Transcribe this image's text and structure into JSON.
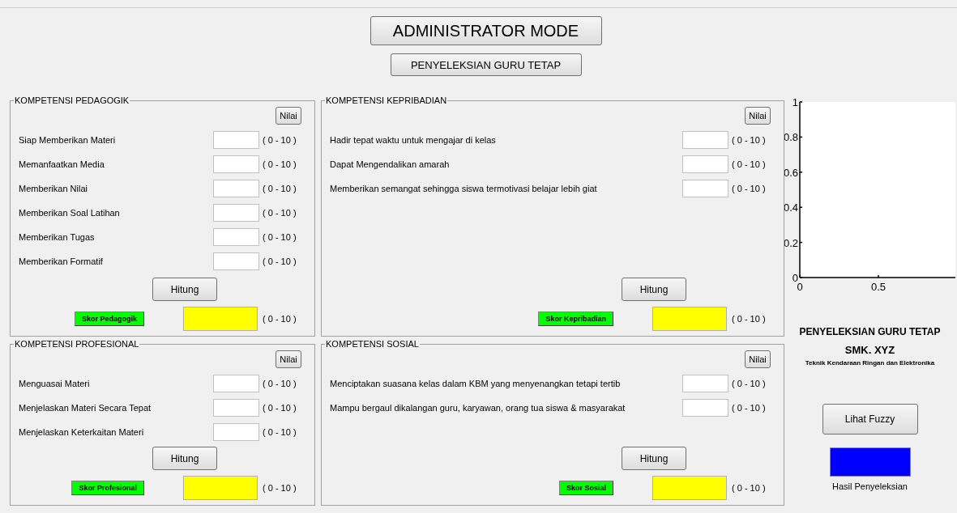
{
  "header": {
    "title": "ADMINISTRATOR MODE",
    "subtitle": "PENYELEKSIAN GURU TETAP"
  },
  "panels": [
    {
      "title": "KOMPETENSI PEDAGOGIK",
      "nilai_button": "Nilai",
      "criteria": [
        {
          "label": "Siap Memberikan Materi",
          "range": "( 0 - 10 )"
        },
        {
          "label": "Memanfaatkan Media",
          "range": "( 0 - 10 )"
        },
        {
          "label": "Memberikan Nilai",
          "range": "( 0 - 10 )"
        },
        {
          "label": "Memberikan Soal Latihan",
          "range": "( 0 - 10 )"
        },
        {
          "label": "Memberikan Tugas",
          "range": "( 0 - 10 )"
        },
        {
          "label": "Memberikan Formatif",
          "range": "( 0 - 10 )"
        }
      ],
      "calculate_button": "Hitung",
      "score_label": "Skor Pedagogik",
      "score_range": "( 0 - 10 )"
    },
    {
      "title": "KOMPETENSI KEPRIBADIAN",
      "nilai_button": "Nilai",
      "criteria": [
        {
          "label": "Hadir tepat waktu untuk mengajar di kelas",
          "range": "( 0 - 10 )"
        },
        {
          "label": "Dapat Mengendalikan amarah",
          "range": "( 0 - 10 )"
        },
        {
          "label": "Memberikan semangat sehingga siswa termotivasi belajar lebih giat",
          "range": "( 0 - 10 )"
        }
      ],
      "calculate_button": "Hitung",
      "score_label": "Skor Kepribadian",
      "score_range": "( 0 - 10 )"
    },
    {
      "title": "KOMPETENSI PROFESIONAL",
      "nilai_button": "Nilai",
      "criteria": [
        {
          "label": "Menguasai Materi",
          "range": "( 0 - 10 )"
        },
        {
          "label": "Menjelaskan Materi Secara Tepat",
          "range": "( 0 - 10 )"
        },
        {
          "label": "Menjelaskan Keterkaitan Materi",
          "range": "( 0 - 10 )"
        }
      ],
      "calculate_button": "Hitung",
      "score_label": "Skor Profesional",
      "score_range": "( 0 - 10 )"
    },
    {
      "title": "KOMPETENSI SOSIAL",
      "nilai_button": "Nilai",
      "criteria": [
        {
          "label": "Menciptakan suasana kelas dalam KBM yang menyenangkan tetapi tertib",
          "range": "( 0 - 10 )"
        },
        {
          "label": "Mampu bergaul dikalangan guru, karyawan, orang tua siswa & masyarakat",
          "range": "( 0 - 10 )"
        }
      ],
      "calculate_button": "Hitung",
      "score_label": "Skor Sosial",
      "score_range": "( 0 - 10 )"
    }
  ],
  "chart": {
    "chart_data": {
      "type": "line",
      "xlim": [
        0,
        1
      ],
      "ylim": [
        0,
        1
      ],
      "xticks": [
        0,
        0.5
      ],
      "yticks": [
        0,
        0.2,
        0.4,
        0.6,
        0.8,
        1
      ]
    },
    "title": "PENYELEKSIAN GURU TETAP",
    "school": "SMK. XYZ",
    "department": "Teknik Kendaraan Ringan dan Elektronika"
  },
  "fuzzy_button": "Lihat Fuzzy",
  "result": {
    "color": "#0000ff",
    "label": "Hasil Penyeleksian"
  }
}
